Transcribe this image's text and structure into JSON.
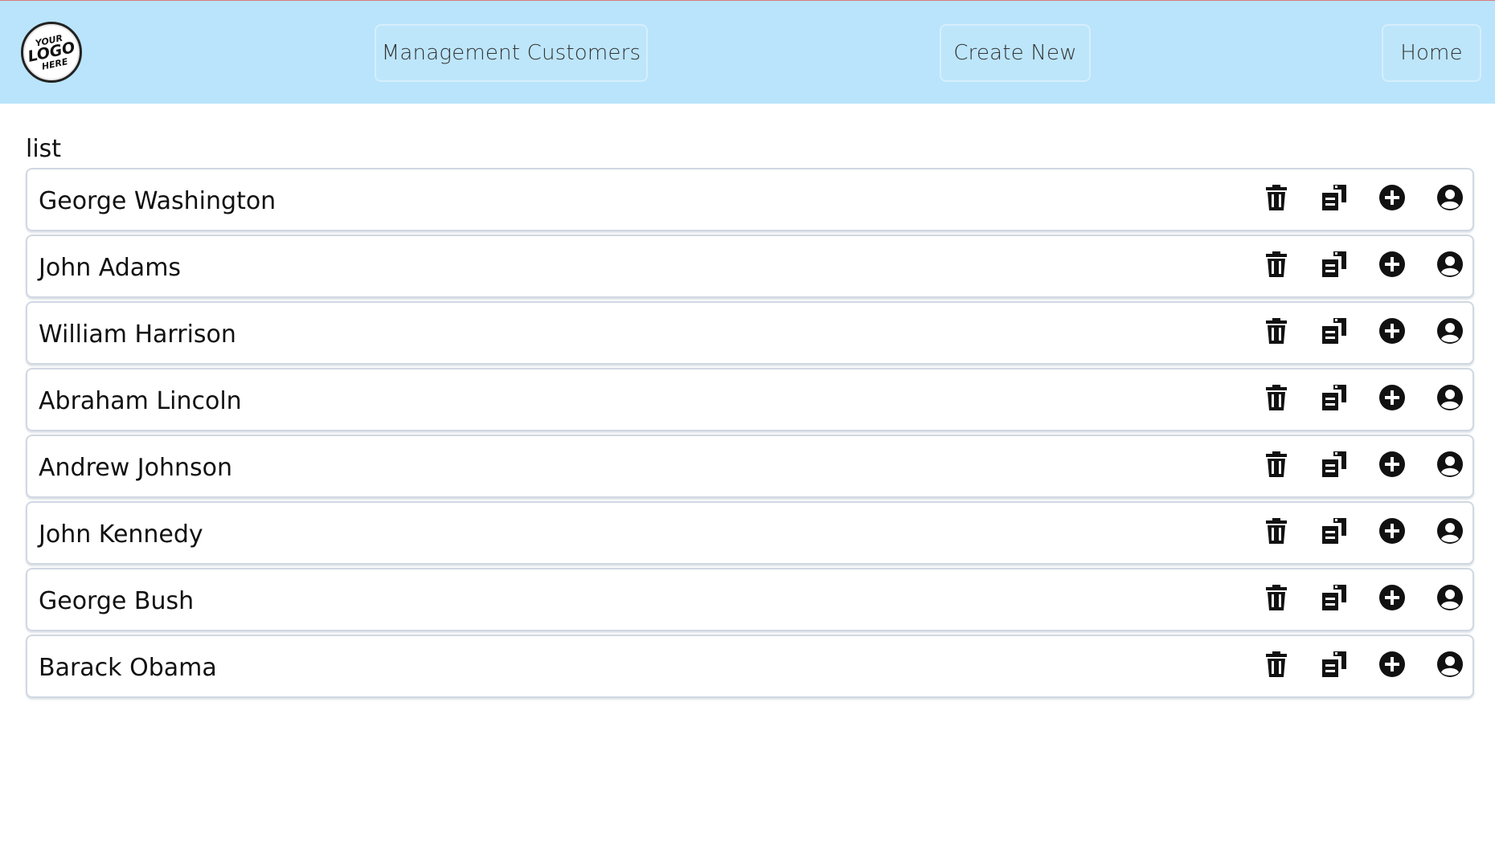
{
  "header": {
    "logo_text": [
      "YOUR",
      "LOGO",
      "HERE"
    ],
    "nav": {
      "management_label": "Management Customers",
      "create_label": "Create New",
      "home_label": "Home"
    },
    "background_color": "#b9e4fb"
  },
  "main": {
    "list_title": "list",
    "items": [
      {
        "name": "George Washington"
      },
      {
        "name": "John Adams"
      },
      {
        "name": "William Harrison"
      },
      {
        "name": "Abraham Lincoln"
      },
      {
        "name": "Andrew Johnson"
      },
      {
        "name": "John Kennedy"
      },
      {
        "name": "George Bush"
      },
      {
        "name": "Barack Obama"
      }
    ],
    "row_actions": [
      "trash-icon",
      "copy-icon",
      "plus-circle-icon",
      "user-circle-icon"
    ]
  }
}
